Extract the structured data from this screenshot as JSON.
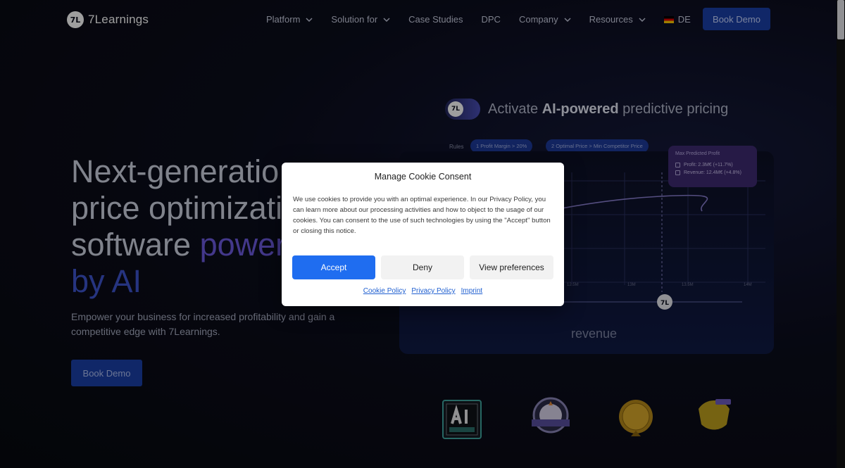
{
  "nav": {
    "logo_mark": "7L",
    "logo_text": "7Learnings",
    "items": [
      {
        "label": "Platform",
        "has_dropdown": true
      },
      {
        "label": "Solution for",
        "has_dropdown": true
      },
      {
        "label": "Case Studies",
        "has_dropdown": false
      },
      {
        "label": "DPC",
        "has_dropdown": false
      },
      {
        "label": "Company",
        "has_dropdown": true
      },
      {
        "label": "Resources",
        "has_dropdown": true
      }
    ],
    "language": "DE",
    "cta": "Book Demo"
  },
  "hero": {
    "title_line1": "Next-generatio",
    "title_line2": "price optimizati",
    "title_line3_plain": "software ",
    "title_line3_accent": "power",
    "title_line4": "by AI",
    "subtitle": "Empower your business for increased profitability and gain a competitive edge with 7Learnings.",
    "cta": "Book Demo"
  },
  "visual": {
    "badge_mark": "7L",
    "activate_prefix": "Activate ",
    "activate_bold": "AI-powered",
    "activate_suffix": " predictive pricing",
    "rules_label": "Rules",
    "rule1": "1  Profit Margin > 20%",
    "rule2": "2  Optimal Price > Min Competitor Price",
    "profit_box_title": "Max Predicted Profit",
    "profit_line": "Profit: 2.3M€ (+11.7%)",
    "revenue_line": "Revenue: 12.4M€ (+4.8%)",
    "x_ticks": [
      "12.5M",
      "13M",
      "13.5M",
      "14M"
    ],
    "revenue_label": "revenue",
    "slider_mark": "7L"
  },
  "cookie": {
    "title": "Manage Cookie Consent",
    "body": "We use cookies to provide you with an optimal experience. In our Privacy Policy, you can learn more about our processing activities and how to object to the usage of our cookies. You can consent to the use of such technologies by using the \"Accept\" button or closing this notice.",
    "accept": "Accept",
    "deny": "Deny",
    "preferences": "View preferences",
    "links": [
      "Cookie Policy",
      "Privacy Policy",
      "Imprint"
    ]
  },
  "colors": {
    "cta_blue": "#1a3fa8",
    "accept_blue": "#1f6df0",
    "accent_purple": "#6d5be0",
    "background": "#0a0b14"
  },
  "icons": {
    "dropdown": "chevron-down-icon",
    "flag": "german-flag-icon"
  }
}
